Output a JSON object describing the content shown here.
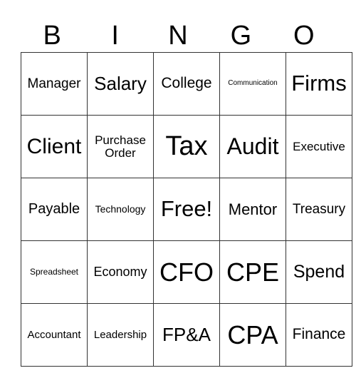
{
  "header": [
    "B",
    "I",
    "N",
    "G",
    "O"
  ],
  "cells": [
    [
      {
        "text": "Manager",
        "size": 19
      },
      {
        "text": "Salary",
        "size": 26
      },
      {
        "text": "College",
        "size": 21
      },
      {
        "text": "Communication",
        "size": 10
      },
      {
        "text": "Firms",
        "size": 31
      }
    ],
    [
      {
        "text": "Client",
        "size": 30
      },
      {
        "text": "Purchase Order",
        "size": 17
      },
      {
        "text": "Tax",
        "size": 38
      },
      {
        "text": "Audit",
        "size": 32
      },
      {
        "text": "Executive",
        "size": 17
      }
    ],
    [
      {
        "text": "Payable",
        "size": 20
      },
      {
        "text": "Technology",
        "size": 14
      },
      {
        "text": "Free!",
        "size": 31
      },
      {
        "text": "Mentor",
        "size": 22
      },
      {
        "text": "Treasury",
        "size": 19
      }
    ],
    [
      {
        "text": "Spreadsheet",
        "size": 12
      },
      {
        "text": "Economy",
        "size": 18
      },
      {
        "text": "CFO",
        "size": 36
      },
      {
        "text": "CPE",
        "size": 36
      },
      {
        "text": "Spend",
        "size": 25
      }
    ],
    [
      {
        "text": "Accountant",
        "size": 15
      },
      {
        "text": "Leadership",
        "size": 15
      },
      {
        "text": "FP&A",
        "size": 26
      },
      {
        "text": "CPA",
        "size": 36
      },
      {
        "text": "Finance",
        "size": 21
      }
    ]
  ]
}
